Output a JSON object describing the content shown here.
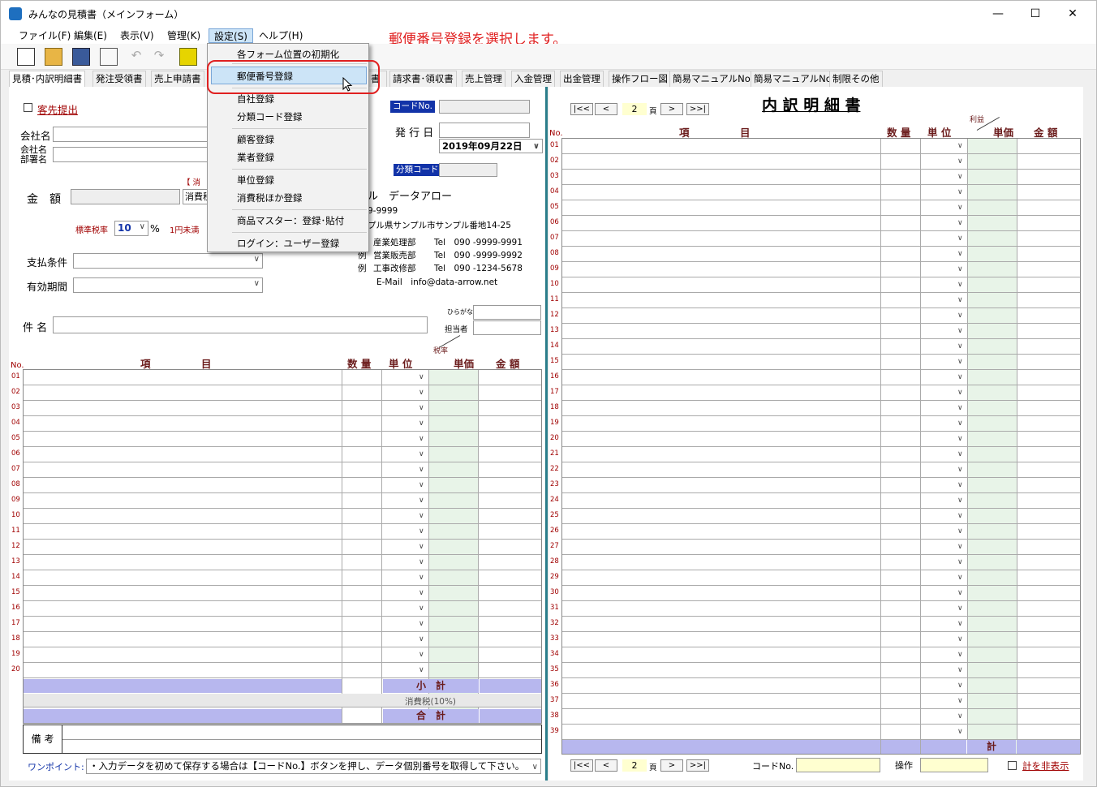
{
  "window": {
    "title": "みんなの見積書（メインフォーム）",
    "minimize": "—",
    "maximize": "☐",
    "close": "✕"
  },
  "annotation": "郵便番号登録を選択します。",
  "menus": [
    "ファイル(F)",
    "編集(E)",
    "表示(V)",
    "管理(K)",
    "設定(S)",
    "ヘルプ(H)"
  ],
  "tabs": [
    "見積･内訳明細書",
    "発注受領書",
    "売上申請書",
    "",
    "請求書･領収書",
    "売上管理",
    "入金管理",
    "出金管理",
    "操作フロー図",
    "簡易マニュアルNo.1",
    "簡易マニュアルNo.2",
    "制限その他"
  ],
  "tab_partial": "書",
  "settings_menu": {
    "items": [
      "各フォーム位置の初期化",
      "郵便番号登録",
      "自社登録",
      "分類コード登録",
      "顧客登録",
      "業者登録",
      "単位登録",
      "消費税ほか登録",
      "商品マスター：登録･貼付",
      "ログイン：ユーザー登録"
    ]
  },
  "left": {
    "kyakusaki": "客先提出",
    "company_name": "会社名",
    "company_dept": "会社名\n部署名",
    "kingaku": "金　額",
    "tax_label": "消費税",
    "bracket": "【 消",
    "std_rate_label": "標準税率",
    "std_rate": "10",
    "pct": "%",
    "rounding": "1円未満",
    "payment": "支払条件",
    "validity": "有効期間",
    "code_no": "コードNo.",
    "issue_date_label": "発 行 日",
    "issue_date": "2019年09月22日",
    "bunrui": "分類コード",
    "issuer": {
      "name": "ル　データアロー",
      "zip": "9-9999",
      "addr": "プル県サンプル市サンプル番地14-25",
      "lines": [
        {
          "prefix": "",
          "dept": "産業処理部",
          "tel": "Tel　090 -9999-9991"
        },
        {
          "prefix": "例",
          "dept": "営業販売部",
          "tel": "Tel　090 -9999-9992"
        },
        {
          "prefix": "例",
          "dept": "工事改修部",
          "tel": "Tel　090 -1234-5678"
        }
      ],
      "email": "E-Mail　info@data-arrow.net"
    },
    "kenmei": "件 名",
    "furigana": "ひらがな",
    "tantou": "担当者",
    "cols": {
      "no": "No.",
      "item": "項　　　　　目",
      "qty": "数 量",
      "unit": "単 位",
      "taxrate": "税率",
      "price": "単価",
      "amount": "金 額"
    },
    "rows": [
      "01",
      "02",
      "03",
      "04",
      "05",
      "06",
      "07",
      "08",
      "09",
      "10",
      "11",
      "12",
      "13",
      "14",
      "15",
      "16",
      "17",
      "18",
      "19",
      "20"
    ],
    "subtotal": "小　計",
    "tax": "消費税(10%)",
    "total": "合　計",
    "biko": "備 考",
    "onepoint": "ワンポイント:",
    "onepoint_text": "・入力データを初めて保存する場合は【コードNo.】ボタンを押し、データ個別番号を取得して下さい。"
  },
  "right": {
    "title": "内 訳 明 細 書",
    "page": "2",
    "page_unit": "頁",
    "nav": [
      "|<<",
      "<",
      ">",
      ">>|"
    ],
    "cols": {
      "no": "No.",
      "item": "項　　　　　目",
      "qty": "数 量",
      "unit": "単 位",
      "profit": "利益",
      "price": "単価",
      "amount": "金 額"
    },
    "rows": [
      "01",
      "02",
      "03",
      "04",
      "05",
      "06",
      "07",
      "08",
      "09",
      "10",
      "11",
      "12",
      "13",
      "14",
      "15",
      "16",
      "17",
      "18",
      "19",
      "20",
      "21",
      "22",
      "23",
      "24",
      "25",
      "26",
      "27",
      "28",
      "29",
      "30",
      "31",
      "32",
      "33",
      "34",
      "35",
      "36",
      "37",
      "38",
      "39"
    ],
    "kei": "計",
    "code_no": "コードNo.",
    "sousa": "操作",
    "hide": "計を非表示"
  }
}
